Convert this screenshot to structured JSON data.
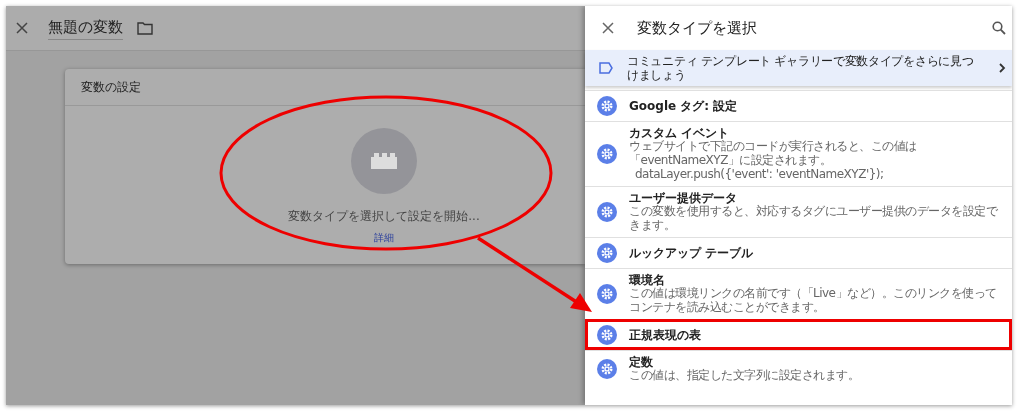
{
  "editor": {
    "title": "無題の変数",
    "card": {
      "title": "変数の設定",
      "prompt": "変数タイプを選択して設定を開始...",
      "link": "詳細"
    }
  },
  "panel": {
    "title": "変数タイプを選択",
    "banner": "コミュニティ テンプレート ギャラリーで変数タイプをさらに見つけましょう",
    "items": [
      {
        "name": "Google タグ: 設定",
        "highlighted": false
      },
      {
        "name": "カスタム イベント",
        "description": "ウェブサイトで下記のコードが実行されると、この値は「eventNameXYZ」に設定されます。",
        "code": "dataLayer.push({'event': 'eventNameXYZ'});",
        "highlighted": false
      },
      {
        "name": "ユーザー提供データ",
        "description": "この変数を使用すると、対応するタグにユーザー提供のデータを設定できます。",
        "highlighted": false
      },
      {
        "name": "ルックアップ テーブル",
        "highlighted": false
      },
      {
        "name": "環境名",
        "description": "この値は環境リンクの名前です（「Live」など）。このリンクを使ってコンテナを読み込むことができます。",
        "highlighted": false
      },
      {
        "name": "正規表現の表",
        "highlighted": true
      },
      {
        "name": "定数",
        "description": "この値は、指定した文字列に設定されます。",
        "highlighted": false
      }
    ]
  }
}
